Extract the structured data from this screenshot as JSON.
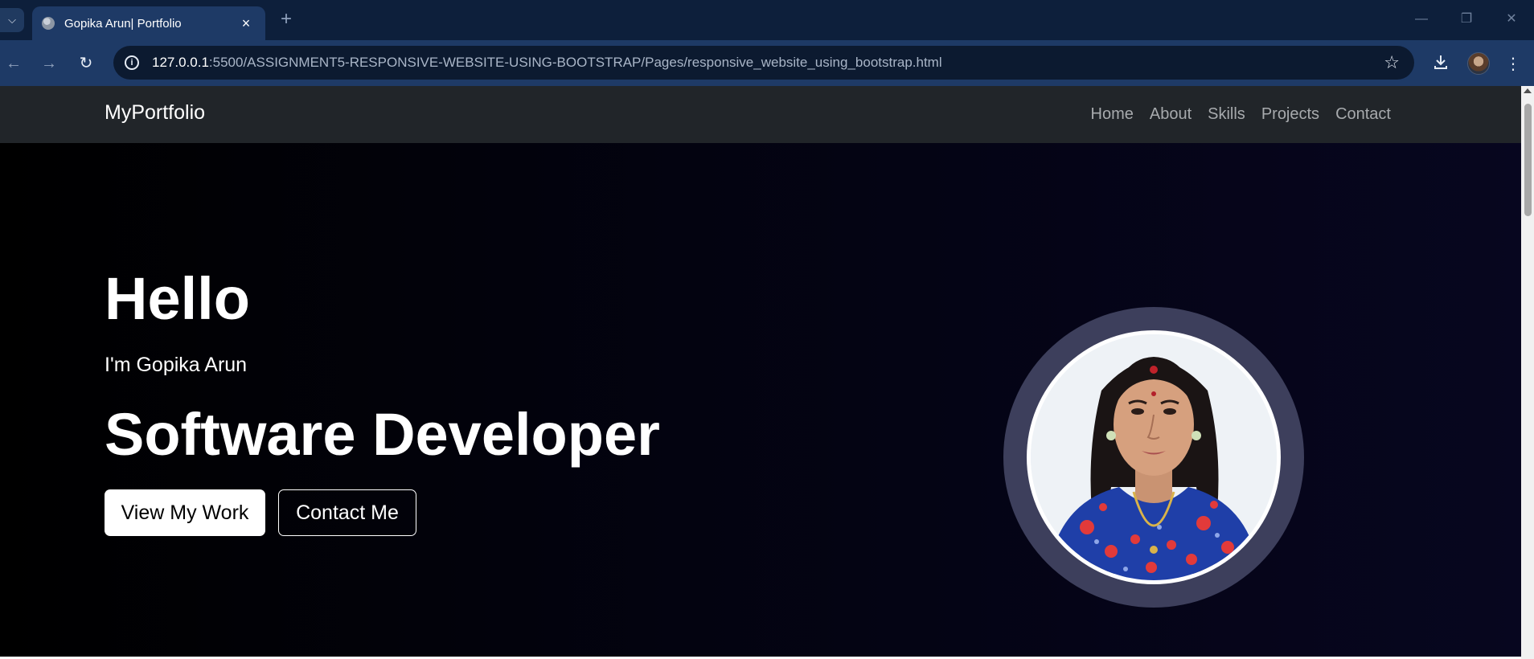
{
  "browser": {
    "tab": {
      "title": "Gopika Arun| Portfolio",
      "close_icon": "×"
    },
    "new_tab_icon": "+",
    "address_bar": {
      "host": "127.0.0.1",
      "path": ":5500/ASSIGNMENT5-RESPONSIVE-WEBSITE-USING-BOOTSTRAP/Pages/responsive_website_using_bootstrap.html"
    },
    "icons": {
      "tab_search": "chevron-down-icon",
      "back": "back-arrow-icon",
      "forward": "forward-arrow-icon",
      "reload": "reload-icon",
      "site_info": "info-icon",
      "bookmark": "star-icon",
      "download": "download-icon",
      "menu": "kebab-menu-icon"
    }
  },
  "site": {
    "brand": "MyPortfolio",
    "nav": [
      "Home",
      "About",
      "Skills",
      "Projects",
      "Contact"
    ]
  },
  "hero": {
    "greeting": "Hello",
    "name_line": "I'm Gopika Arun",
    "role": "Software Developer",
    "primary_button": "View My Work",
    "secondary_button": "Contact Me",
    "photo": "profile-photo",
    "colors": {
      "background_start": "#000000",
      "background_end": "#07061f",
      "ring": "#3d3f5c",
      "navbar": "#212529"
    }
  }
}
